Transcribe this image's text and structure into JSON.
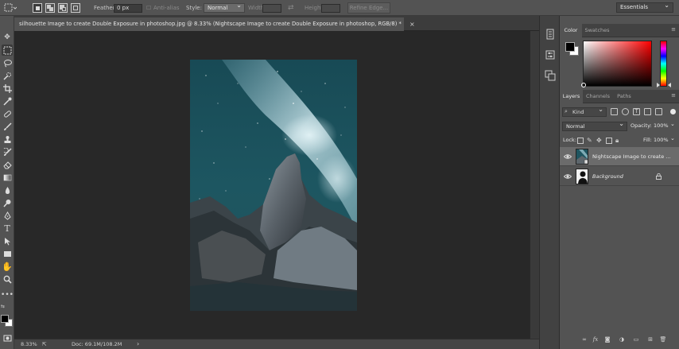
{
  "options_bar": {
    "feather_label": "Feather:",
    "feather_value": "0 px",
    "antialias_label": "Anti-alias",
    "style_label": "Style:",
    "style_value": "Normal",
    "width_label": "Width:",
    "height_label": "Height:",
    "refine_label": "Refine Edge...",
    "workspace": "Essentials"
  },
  "document": {
    "tab_title": "silhouette Image to create Double Exposure in photoshop.jpg @ 8.33% (Nightscape Image to create Double Exposure in photoshop, RGB/8) *",
    "close_glyph": "×"
  },
  "status_bar": {
    "zoom": "8.33%",
    "doc_info": "Doc: 69.1M/108.2M",
    "arrow_glyph": "›"
  },
  "color_panel": {
    "tabs": [
      "Color",
      "Swatches"
    ],
    "fg_color": "#000000",
    "bg_color": "#ffffff"
  },
  "layers_panel": {
    "tabs": [
      "Layers",
      "Channels",
      "Paths"
    ],
    "kind_label": "Kind",
    "blend_mode": "Normal",
    "opacity_label": "Opacity:",
    "opacity_value": "100%",
    "lock_label": "Lock:",
    "fill_label": "Fill:",
    "fill_value": "100%",
    "layers": [
      {
        "name": "Nightscape Image to create ...",
        "visible": true,
        "selected": true
      },
      {
        "name": "Background",
        "visible": true,
        "selected": false,
        "locked": true
      }
    ],
    "footer_fx": "fx"
  },
  "colors": {
    "accent_bg": "#535353",
    "canvas_bg": "#282828",
    "selected_layer": "#6b6b6b"
  }
}
